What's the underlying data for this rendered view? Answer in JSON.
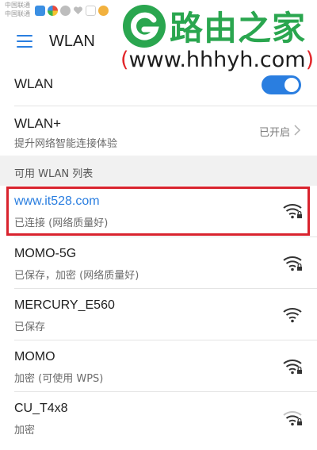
{
  "status_bar": {
    "carrier_1": "中国联通",
    "carrier_2": "中国联通",
    "notification_icons": [
      {
        "name": "app-blue-icon",
        "color": "#3b8fe3"
      },
      {
        "name": "app-colorful-icon",
        "color": "#e9b63a"
      },
      {
        "name": "app-gray-icon",
        "color": "#bdbdbd"
      },
      {
        "name": "app-heart-icon",
        "color": "#bdbdbd"
      },
      {
        "name": "app-outline-icon",
        "color": "#cfcfcf"
      },
      {
        "name": "app-pig-icon",
        "color": "#f2b13e"
      }
    ]
  },
  "watermark": {
    "title": "路由之家",
    "url_open": "(",
    "url_text": "www.hhhyh.com",
    "url_close": ")",
    "brand_color": "#2aa64f"
  },
  "header": {
    "menu_icon": "menu-icon",
    "title": "WLAN"
  },
  "wlan_toggle": {
    "label": "WLAN",
    "state": "on",
    "accent_color": "#2a7ee0"
  },
  "wlan_plus": {
    "title": "WLAN+",
    "subtitle": "提升网络智能连接体验",
    "status": "已开启"
  },
  "section": {
    "label": "可用 WLAN 列表"
  },
  "networks": [
    {
      "name": "www.it528.com",
      "status": "已连接 (网络质量好)",
      "connected": true,
      "secured": true,
      "signal": "full"
    },
    {
      "name": "MOMO-5G",
      "status": "已保存，加密 (网络质量好)",
      "connected": false,
      "secured": true,
      "signal": "full"
    },
    {
      "name": "MERCURY_E560",
      "status": "已保存",
      "connected": false,
      "secured": false,
      "signal": "full"
    },
    {
      "name": "MOMO",
      "status": "加密 (可使用 WPS)",
      "connected": false,
      "secured": true,
      "signal": "full"
    },
    {
      "name": "CU_T4x8",
      "status": "加密",
      "connected": false,
      "secured": true,
      "signal": "medium"
    }
  ],
  "highlight_color": "#d9232e"
}
